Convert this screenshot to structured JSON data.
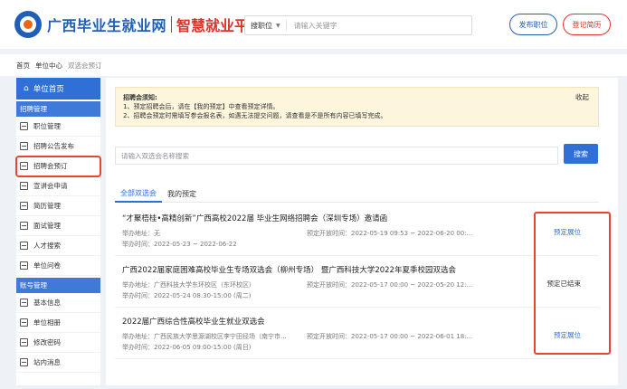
{
  "header": {
    "brand": "广西毕业生就业网",
    "brand_sub": "智慧就业平台",
    "search_type": "搜职位",
    "search_placeholder": "请输入关键字",
    "post_button": "发布职位",
    "login_button": "登记简历",
    "brand_color": "#1f5fb8",
    "accent_color": "#d9342b"
  },
  "breadcrumb": [
    "首页",
    "单位中心",
    "双选会预订"
  ],
  "sidebar": {
    "home": "单位首页",
    "groups": [
      {
        "label": "招聘管理",
        "items": [
          "职位管理",
          "招聘公告发布",
          "招聘会预订",
          "宣讲会申请",
          "简历管理",
          "面试管理",
          "人才搜索",
          "单位问卷"
        ]
      },
      {
        "label": "账号管理",
        "items": [
          "基本信息",
          "单位相册",
          "修改密码",
          "站内消息"
        ]
      }
    ],
    "active_item": "招聘会预订"
  },
  "notice": {
    "title": "招聘会须知:",
    "lines": [
      "1、预定招聘会后，请在【我的预定】中查看预定详情。",
      "2、招聘会预定时需填写参会报名表，如遇无法提交问题，请查看是不是所有内容已填写完成。"
    ],
    "close": "收起"
  },
  "filter": {
    "placeholder": "请输入双选会名称搜索",
    "button": "搜索"
  },
  "tabs": [
    "全部双选会",
    "我的预定"
  ],
  "fairs": [
    {
      "title": "“才聚梧桂•高精创新”广西高校2022届 毕业生网络招聘会（深圳专场）邀请函",
      "address": "举办地址：无",
      "time": "举办时间：2022-05-23 ~ 2022-06-22",
      "open": "预定开放时间：2022-05-19 09:53 ~ 2022-06-20 00:...",
      "action": "预定展位"
    },
    {
      "title": "广西2022届家庭困难高校毕业生专场双选会（柳州专场） 暨广西科技大学2022年夏季校园双选会",
      "address": "举办地址：广西科技大学东环校区（东环校区）",
      "time": "举办时间：2022-05-24 08:30-15:00 (周二)",
      "open": "预定开放时间：2022-05-17 00:00 ~ 2022-05-20 12:...",
      "action": "预定已结束"
    },
    {
      "title": "2022届广西综合性高校毕业生就业双选会",
      "address": "举办地址：广西民族大学思源湖校区李宁田径场（南宁市...",
      "time": "举办时间：2022-06-05 09:00-15:00 (周日)",
      "open": "预定开放时间：2022-05-17 00:00 ~ 2022-06-01 18:...",
      "action": "预定展位"
    }
  ]
}
